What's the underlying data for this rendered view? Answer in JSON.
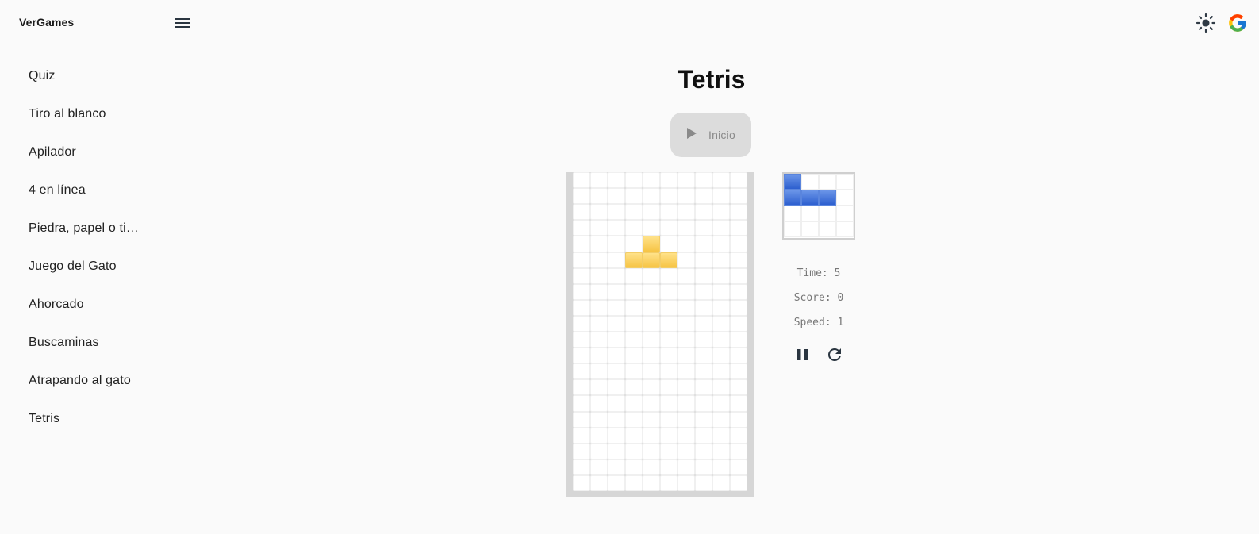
{
  "app": {
    "brand": "VerGames"
  },
  "header": {
    "menu_icon": "hamburger-menu-icon",
    "theme_icon": "sun-icon",
    "login_icon": "google-icon"
  },
  "sidebar": {
    "items": [
      {
        "label": "Quiz"
      },
      {
        "label": "Tiro al blanco"
      },
      {
        "label": "Apilador"
      },
      {
        "label": "4 en línea"
      },
      {
        "label": "Piedra, papel o tijeras"
      },
      {
        "label": "Juego del Gato"
      },
      {
        "label": "Ahorcado"
      },
      {
        "label": "Buscaminas"
      },
      {
        "label": "Atrapando al gato"
      },
      {
        "label": "Tetris"
      }
    ]
  },
  "game": {
    "title": "Tetris",
    "start_label": "Inicio",
    "board": {
      "cols": 10,
      "rows": 20,
      "filled": [
        {
          "r": 4,
          "c": 4,
          "color": "yellow"
        },
        {
          "r": 5,
          "c": 3,
          "color": "yellow"
        },
        {
          "r": 5,
          "c": 4,
          "color": "yellow"
        },
        {
          "r": 5,
          "c": 5,
          "color": "yellow"
        }
      ]
    },
    "next_piece": {
      "cols": 4,
      "rows": 4,
      "filled": [
        {
          "r": 0,
          "c": 0,
          "color": "blue"
        },
        {
          "r": 1,
          "c": 0,
          "color": "blue"
        },
        {
          "r": 1,
          "c": 1,
          "color": "blue"
        },
        {
          "r": 1,
          "c": 2,
          "color": "blue"
        }
      ]
    },
    "stats": {
      "time": "Time: 5",
      "score": "Score: 0",
      "speed": "Speed: 1"
    },
    "controls": {
      "pause_icon": "pause-icon",
      "restart_icon": "restart-icon"
    }
  },
  "colors": {
    "yellow": "#f6c445",
    "blue": "#2d5fcf",
    "board_frame": "#d6d6d6",
    "button_bg": "#dcdcdc"
  }
}
